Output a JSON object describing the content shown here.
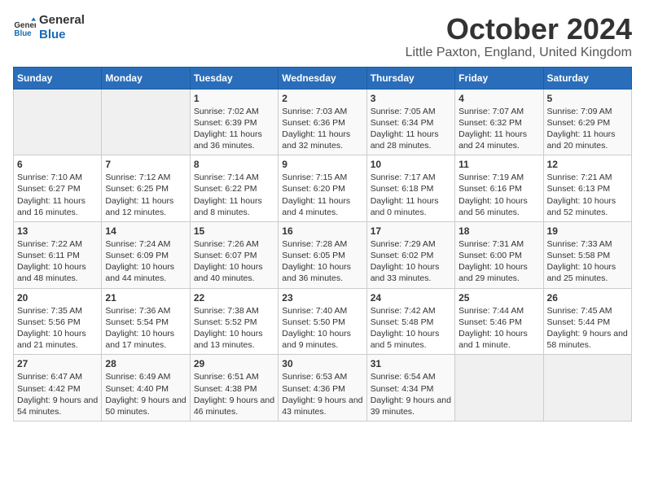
{
  "logo": {
    "line1": "General",
    "line2": "Blue"
  },
  "title": "October 2024",
  "location": "Little Paxton, England, United Kingdom",
  "days_of_week": [
    "Sunday",
    "Monday",
    "Tuesday",
    "Wednesday",
    "Thursday",
    "Friday",
    "Saturday"
  ],
  "weeks": [
    [
      {
        "day": "",
        "sunrise": "",
        "sunset": "",
        "daylight": ""
      },
      {
        "day": "",
        "sunrise": "",
        "sunset": "",
        "daylight": ""
      },
      {
        "day": "1",
        "sunrise": "Sunrise: 7:02 AM",
        "sunset": "Sunset: 6:39 PM",
        "daylight": "Daylight: 11 hours and 36 minutes."
      },
      {
        "day": "2",
        "sunrise": "Sunrise: 7:03 AM",
        "sunset": "Sunset: 6:36 PM",
        "daylight": "Daylight: 11 hours and 32 minutes."
      },
      {
        "day": "3",
        "sunrise": "Sunrise: 7:05 AM",
        "sunset": "Sunset: 6:34 PM",
        "daylight": "Daylight: 11 hours and 28 minutes."
      },
      {
        "day": "4",
        "sunrise": "Sunrise: 7:07 AM",
        "sunset": "Sunset: 6:32 PM",
        "daylight": "Daylight: 11 hours and 24 minutes."
      },
      {
        "day": "5",
        "sunrise": "Sunrise: 7:09 AM",
        "sunset": "Sunset: 6:29 PM",
        "daylight": "Daylight: 11 hours and 20 minutes."
      }
    ],
    [
      {
        "day": "6",
        "sunrise": "Sunrise: 7:10 AM",
        "sunset": "Sunset: 6:27 PM",
        "daylight": "Daylight: 11 hours and 16 minutes."
      },
      {
        "day": "7",
        "sunrise": "Sunrise: 7:12 AM",
        "sunset": "Sunset: 6:25 PM",
        "daylight": "Daylight: 11 hours and 12 minutes."
      },
      {
        "day": "8",
        "sunrise": "Sunrise: 7:14 AM",
        "sunset": "Sunset: 6:22 PM",
        "daylight": "Daylight: 11 hours and 8 minutes."
      },
      {
        "day": "9",
        "sunrise": "Sunrise: 7:15 AM",
        "sunset": "Sunset: 6:20 PM",
        "daylight": "Daylight: 11 hours and 4 minutes."
      },
      {
        "day": "10",
        "sunrise": "Sunrise: 7:17 AM",
        "sunset": "Sunset: 6:18 PM",
        "daylight": "Daylight: 11 hours and 0 minutes."
      },
      {
        "day": "11",
        "sunrise": "Sunrise: 7:19 AM",
        "sunset": "Sunset: 6:16 PM",
        "daylight": "Daylight: 10 hours and 56 minutes."
      },
      {
        "day": "12",
        "sunrise": "Sunrise: 7:21 AM",
        "sunset": "Sunset: 6:13 PM",
        "daylight": "Daylight: 10 hours and 52 minutes."
      }
    ],
    [
      {
        "day": "13",
        "sunrise": "Sunrise: 7:22 AM",
        "sunset": "Sunset: 6:11 PM",
        "daylight": "Daylight: 10 hours and 48 minutes."
      },
      {
        "day": "14",
        "sunrise": "Sunrise: 7:24 AM",
        "sunset": "Sunset: 6:09 PM",
        "daylight": "Daylight: 10 hours and 44 minutes."
      },
      {
        "day": "15",
        "sunrise": "Sunrise: 7:26 AM",
        "sunset": "Sunset: 6:07 PM",
        "daylight": "Daylight: 10 hours and 40 minutes."
      },
      {
        "day": "16",
        "sunrise": "Sunrise: 7:28 AM",
        "sunset": "Sunset: 6:05 PM",
        "daylight": "Daylight: 10 hours and 36 minutes."
      },
      {
        "day": "17",
        "sunrise": "Sunrise: 7:29 AM",
        "sunset": "Sunset: 6:02 PM",
        "daylight": "Daylight: 10 hours and 33 minutes."
      },
      {
        "day": "18",
        "sunrise": "Sunrise: 7:31 AM",
        "sunset": "Sunset: 6:00 PM",
        "daylight": "Daylight: 10 hours and 29 minutes."
      },
      {
        "day": "19",
        "sunrise": "Sunrise: 7:33 AM",
        "sunset": "Sunset: 5:58 PM",
        "daylight": "Daylight: 10 hours and 25 minutes."
      }
    ],
    [
      {
        "day": "20",
        "sunrise": "Sunrise: 7:35 AM",
        "sunset": "Sunset: 5:56 PM",
        "daylight": "Daylight: 10 hours and 21 minutes."
      },
      {
        "day": "21",
        "sunrise": "Sunrise: 7:36 AM",
        "sunset": "Sunset: 5:54 PM",
        "daylight": "Daylight: 10 hours and 17 minutes."
      },
      {
        "day": "22",
        "sunrise": "Sunrise: 7:38 AM",
        "sunset": "Sunset: 5:52 PM",
        "daylight": "Daylight: 10 hours and 13 minutes."
      },
      {
        "day": "23",
        "sunrise": "Sunrise: 7:40 AM",
        "sunset": "Sunset: 5:50 PM",
        "daylight": "Daylight: 10 hours and 9 minutes."
      },
      {
        "day": "24",
        "sunrise": "Sunrise: 7:42 AM",
        "sunset": "Sunset: 5:48 PM",
        "daylight": "Daylight: 10 hours and 5 minutes."
      },
      {
        "day": "25",
        "sunrise": "Sunrise: 7:44 AM",
        "sunset": "Sunset: 5:46 PM",
        "daylight": "Daylight: 10 hours and 1 minute."
      },
      {
        "day": "26",
        "sunrise": "Sunrise: 7:45 AM",
        "sunset": "Sunset: 5:44 PM",
        "daylight": "Daylight: 9 hours and 58 minutes."
      }
    ],
    [
      {
        "day": "27",
        "sunrise": "Sunrise: 6:47 AM",
        "sunset": "Sunset: 4:42 PM",
        "daylight": "Daylight: 9 hours and 54 minutes."
      },
      {
        "day": "28",
        "sunrise": "Sunrise: 6:49 AM",
        "sunset": "Sunset: 4:40 PM",
        "daylight": "Daylight: 9 hours and 50 minutes."
      },
      {
        "day": "29",
        "sunrise": "Sunrise: 6:51 AM",
        "sunset": "Sunset: 4:38 PM",
        "daylight": "Daylight: 9 hours and 46 minutes."
      },
      {
        "day": "30",
        "sunrise": "Sunrise: 6:53 AM",
        "sunset": "Sunset: 4:36 PM",
        "daylight": "Daylight: 9 hours and 43 minutes."
      },
      {
        "day": "31",
        "sunrise": "Sunrise: 6:54 AM",
        "sunset": "Sunset: 4:34 PM",
        "daylight": "Daylight: 9 hours and 39 minutes."
      },
      {
        "day": "",
        "sunrise": "",
        "sunset": "",
        "daylight": ""
      },
      {
        "day": "",
        "sunrise": "",
        "sunset": "",
        "daylight": ""
      }
    ]
  ]
}
